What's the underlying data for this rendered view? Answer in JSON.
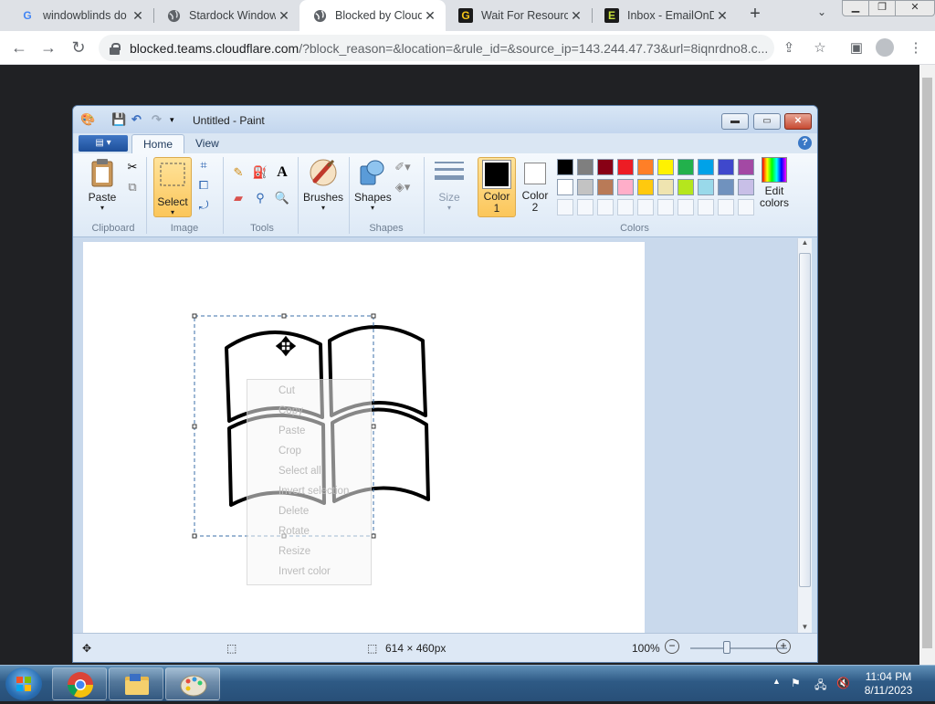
{
  "browser": {
    "tabs": [
      {
        "title": "windowblinds do",
        "favicon": "G"
      },
      {
        "title": "Stardock Window",
        "favicon": "globe-icon"
      },
      {
        "title": "Blocked by Cloud",
        "favicon": "globe-icon"
      },
      {
        "title": "Wait For Resource",
        "favicon": "G"
      },
      {
        "title": "Inbox - EmailOnD",
        "favicon": "E"
      }
    ],
    "url_host": "blocked.teams.cloudflare.com",
    "url_rest": "/?block_reason=&location=&rule_id=&source_ip=143.244.47.73&url=8iqnrdno8.c..."
  },
  "paint": {
    "title": "Untitled - Paint",
    "tabs": [
      "Home",
      "View"
    ],
    "ribbon": {
      "paste": "Paste",
      "select": "Select",
      "brushes": "Brushes",
      "shapes": "Shapes",
      "size": "Size",
      "color1": "Color\n1",
      "color2": "Color\n2",
      "edit_colors": "Edit\ncolors",
      "groups": [
        "Clipboard",
        "Image",
        "Tools",
        "Shapes",
        "Colors"
      ]
    },
    "palette": [
      "#000000",
      "#7f7f7f",
      "#880015",
      "#ed1c24",
      "#ff7f27",
      "#fff200",
      "#22b14c",
      "#00a2e8",
      "#3f48cc",
      "#a349a4",
      "#ffffff",
      "#c3c3c3",
      "#b97a57",
      "#ffaec9",
      "#ffc90e",
      "#efe4b0",
      "#b5e61d",
      "#99d9ea",
      "#7092be",
      "#c8bfe7"
    ],
    "context_menu": [
      "Cut",
      "Copy",
      "Paste",
      "Crop",
      "Select all",
      "Invert selection",
      "Delete",
      "Rotate",
      "Resize",
      "Invert color"
    ],
    "status": {
      "size": "614 × 460px",
      "zoom": "100%"
    }
  },
  "taskbar": {
    "time": "11:04 PM",
    "date": "8/11/2023"
  }
}
